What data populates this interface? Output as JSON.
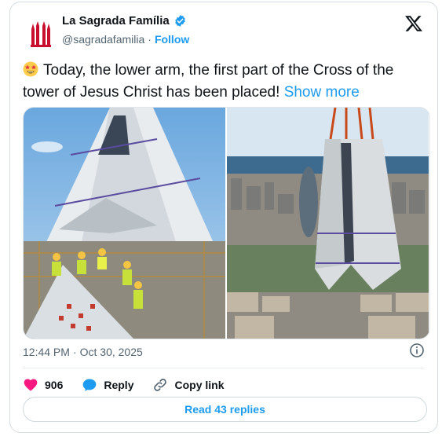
{
  "author": {
    "display_name": "La Sagrada Família",
    "handle": "@sagradafamilia",
    "separator": "·",
    "follow_label": "Follow",
    "verified": true
  },
  "tweet": {
    "emoji": "star-struck",
    "text": "Today, the lower arm, the first part of the Cross of the tower of Jesus Christ has been placed!",
    "show_more_label": "Show more"
  },
  "media": {
    "images": [
      "tower-cross-worker-scene",
      "tower-cross-crane-lift-city-view"
    ]
  },
  "meta": {
    "time": "12:44 PM",
    "separator": "·",
    "date": "Oct 30, 2025"
  },
  "actions": {
    "like_count": "906",
    "reply_label": "Reply",
    "copy_link_label": "Copy link"
  },
  "read_replies_label": "Read 43 replies",
  "colors": {
    "accent": "#1d9bf0",
    "like": "#f91880",
    "text": "#0f1419",
    "muted": "#536471",
    "brand": "#c8102e"
  }
}
